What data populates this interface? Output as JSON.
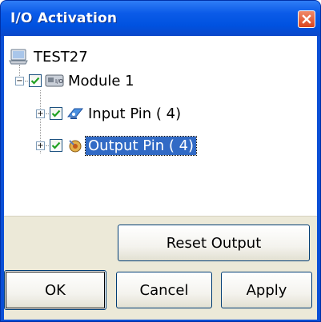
{
  "window": {
    "title": "I/O Activation",
    "close_icon": "close-icon"
  },
  "tree": {
    "root": {
      "label": "TEST27",
      "icon": "computer-icon"
    },
    "module": {
      "label": "Module 1",
      "checked": true,
      "expanded": true,
      "icon": "module-icon"
    },
    "children": [
      {
        "label": "Input Pin ( 4)",
        "checked": true,
        "expanded": false,
        "icon": "input-pin-icon",
        "selected": false
      },
      {
        "label": "Output Pin ( 4)",
        "checked": true,
        "expanded": false,
        "icon": "output-pin-icon",
        "selected": true
      }
    ]
  },
  "buttons": {
    "reset_output": "Reset Output",
    "ok": "OK",
    "cancel": "Cancel",
    "apply": "Apply"
  },
  "colors": {
    "title_bar": "#0b5be8",
    "selection": "#316ac5",
    "check": "#21a121",
    "dialog_bg": "#ece9d8"
  }
}
